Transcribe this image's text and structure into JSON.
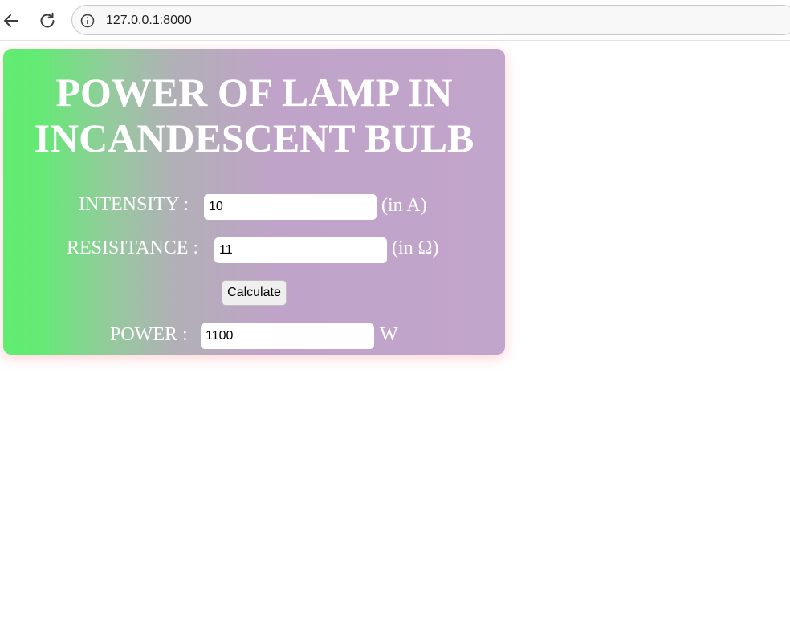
{
  "browser": {
    "url": "127.0.0.1:8000",
    "back_icon": "back-arrow-icon",
    "reload_icon": "reload-icon",
    "info_icon": "info-icon"
  },
  "card": {
    "title_line1": "POWER OF LAMP IN",
    "title_line2": "INCANDESCENT BULB",
    "intensity": {
      "label": "INTENSITY :",
      "value": "10",
      "unit": "(in A)"
    },
    "resistance": {
      "label": "RESISITANCE :",
      "value": "11",
      "unit": "(in Ω)"
    },
    "calculate_label": "Calculate",
    "power": {
      "label": "POWER :",
      "value": "1100",
      "unit": "W"
    }
  },
  "colors": {
    "gradient_start": "#62ec72",
    "gradient_end": "#c2a5cb",
    "text": "#ffffff"
  }
}
